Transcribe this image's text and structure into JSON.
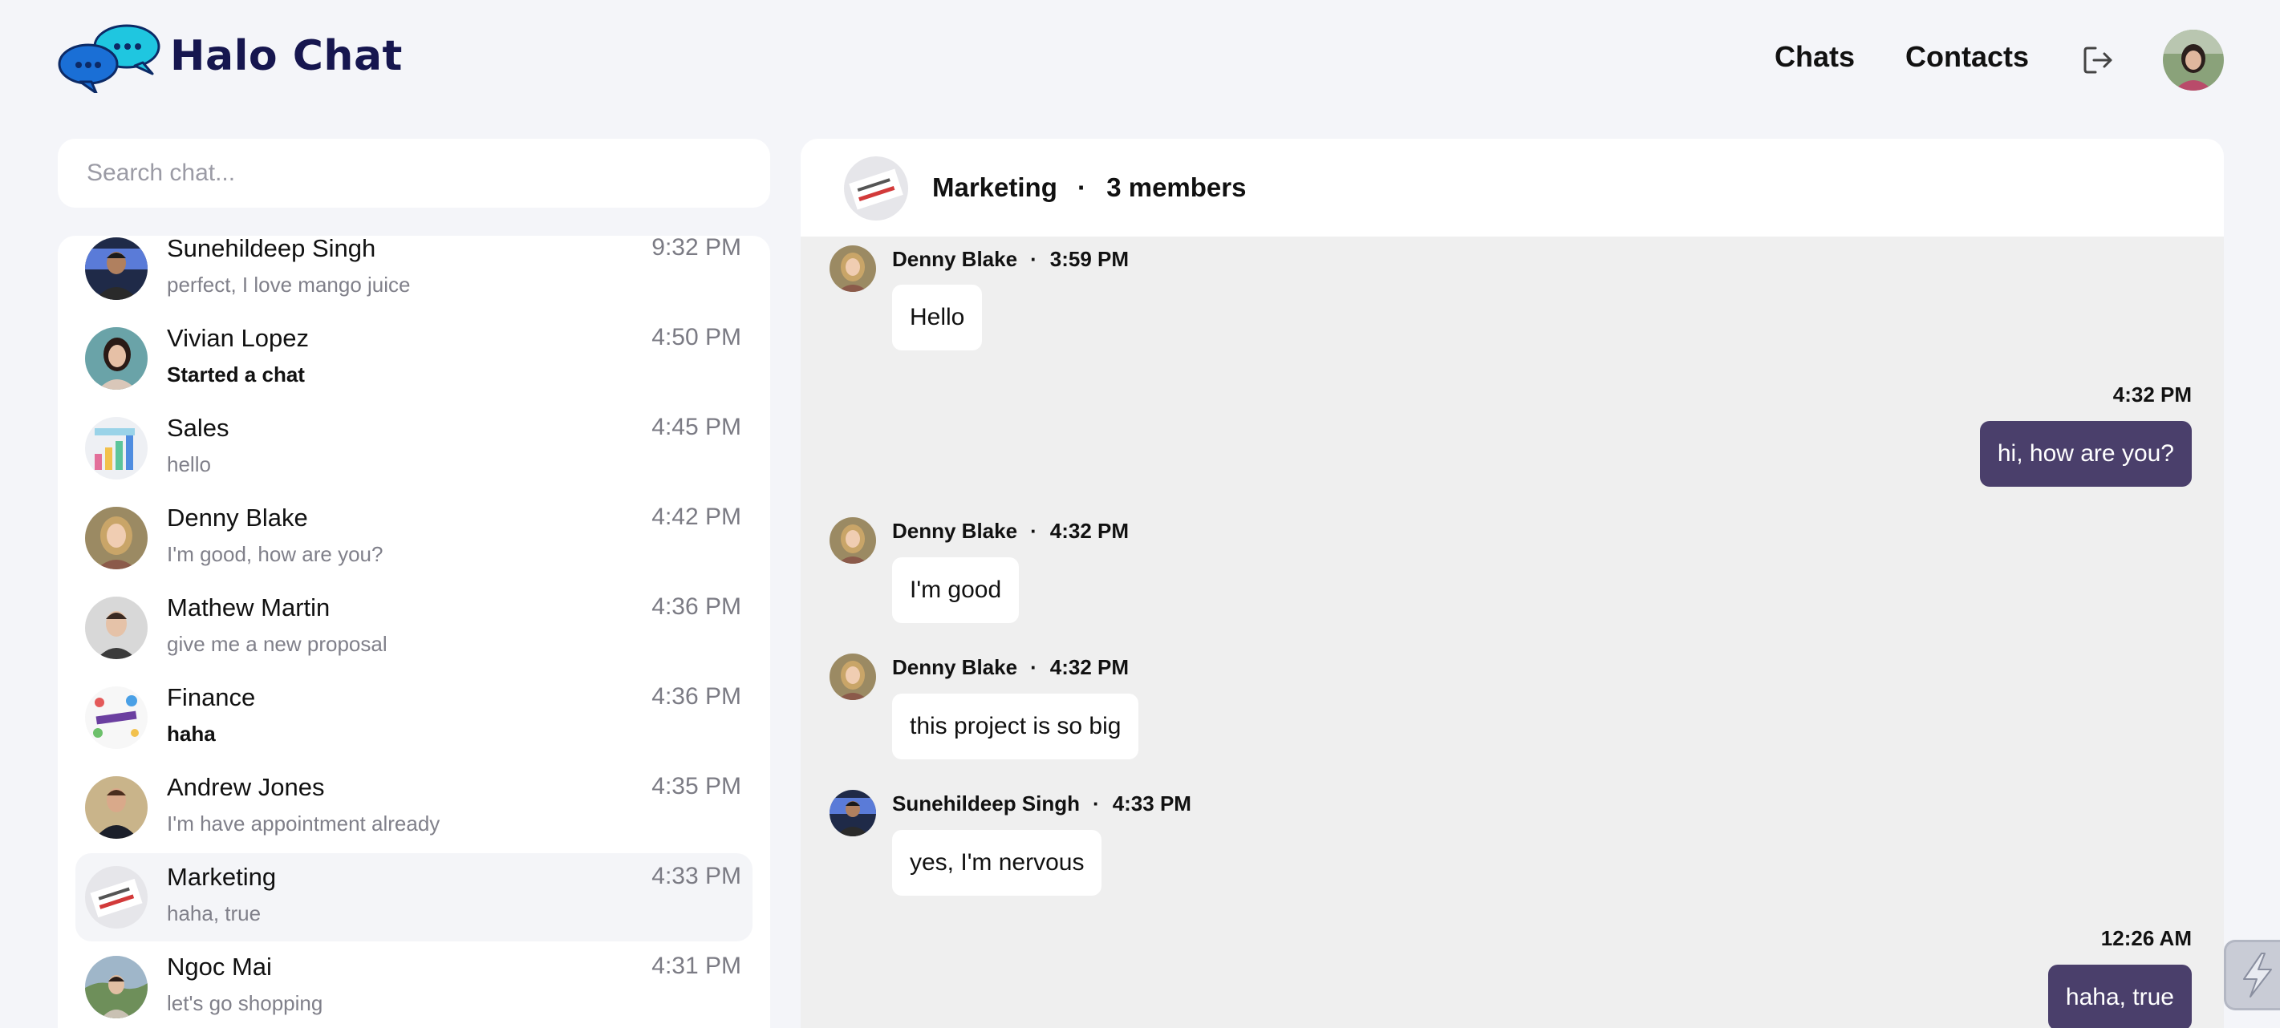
{
  "app": {
    "brand": "Halo Chat",
    "nav": {
      "chats": "Chats",
      "contacts": "Contacts"
    }
  },
  "search": {
    "placeholder": "Search chat..."
  },
  "chat_list": [
    {
      "name": "Sunehildeep Singh",
      "time": "9:32 PM",
      "preview": "perfect, I love mango juice",
      "strong": false
    },
    {
      "name": "Vivian Lopez",
      "time": "4:50 PM",
      "preview": "Started a chat",
      "strong": true
    },
    {
      "name": "Sales",
      "time": "4:45 PM",
      "preview": "hello",
      "strong": false
    },
    {
      "name": "Denny Blake",
      "time": "4:42 PM",
      "preview": "I'm good, how are you?",
      "strong": false
    },
    {
      "name": "Mathew Martin",
      "time": "4:36 PM",
      "preview": "give me a new proposal",
      "strong": false
    },
    {
      "name": "Finance",
      "time": "4:36 PM",
      "preview": "haha",
      "strong": true
    },
    {
      "name": "Andrew Jones",
      "time": "4:35 PM",
      "preview": "I'm have appointment already",
      "strong": false
    },
    {
      "name": "Marketing",
      "time": "4:33 PM",
      "preview": "haha, true",
      "strong": false,
      "active": true
    },
    {
      "name": "Ngoc Mai",
      "time": "4:31 PM",
      "preview": "let's go shopping",
      "strong": false
    }
  ],
  "conversation": {
    "title": "Marketing",
    "separator": "·",
    "members": "3 members",
    "messages": [
      {
        "direction": "in",
        "sender": "Denny Blake",
        "time": "3:59 PM",
        "text": "Hello"
      },
      {
        "direction": "out",
        "time": "4:32 PM",
        "text": "hi, how are you?"
      },
      {
        "direction": "in",
        "sender": "Denny Blake",
        "time": "4:32 PM",
        "text": "I'm good"
      },
      {
        "direction": "in",
        "sender": "Denny Blake",
        "time": "4:32 PM",
        "text": "this project is so big"
      },
      {
        "direction": "in",
        "sender": "Sunehildeep Singh",
        "time": "4:33 PM",
        "text": "yes, I'm nervous"
      },
      {
        "direction": "out",
        "time": "12:26 AM",
        "text": "haha, true"
      }
    ]
  },
  "colors": {
    "brand": "#16164f",
    "outgoing_bubble": "#4a3f6b",
    "logo_blue": "#1a6fd6",
    "logo_cyan": "#1fc6e0"
  }
}
